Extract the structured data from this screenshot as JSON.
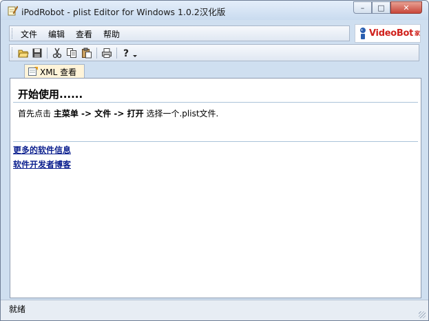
{
  "window": {
    "title": "iPodRobot - plist Editor for Windows 1.0.2汉化版",
    "controls": {
      "minimize": "–",
      "maximize": "□",
      "close": "✕"
    }
  },
  "menu": {
    "items": [
      {
        "label": "文件"
      },
      {
        "label": "编辑"
      },
      {
        "label": "查看"
      },
      {
        "label": "帮助"
      }
    ]
  },
  "logo": {
    "text": "VideoBot",
    "mark": "家"
  },
  "toolbar": {
    "buttons": [
      "open-folder-icon",
      "save-icon",
      "cut-icon",
      "copy-icon",
      "paste-icon",
      "print-icon",
      "help-icon"
    ]
  },
  "tab": {
    "label": "XML 查看"
  },
  "content": {
    "heading": "开始使用......",
    "instruction": {
      "prefix": "首先点击 ",
      "step1": "主菜单",
      "arrow1": " -> ",
      "step2": "文件",
      "arrow2": " -> ",
      "step3": "打开",
      "suffix": " 选择一个.plist文件."
    },
    "links": [
      {
        "text": "更多的软件信息"
      },
      {
        "text": "软件开发者博客"
      }
    ]
  },
  "status": {
    "text": "就绪"
  }
}
